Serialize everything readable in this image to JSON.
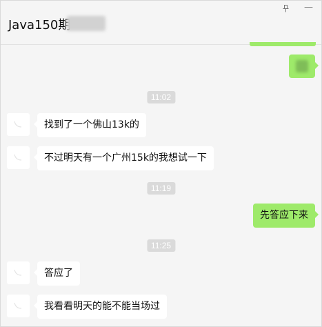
{
  "header": {
    "title": "Java150期"
  },
  "window_controls": {
    "pin_icon": "pin-icon",
    "minimize_icon": "minimize-icon"
  },
  "messages": [
    {
      "type": "time",
      "text": "11:02"
    },
    {
      "type": "incoming",
      "text": "找到了一个佛山13k的"
    },
    {
      "type": "incoming",
      "text": "不过明天有一个广州15k的我想试一下"
    },
    {
      "type": "time",
      "text": "11:19"
    },
    {
      "type": "outgoing",
      "text": "先答应下来"
    },
    {
      "type": "time",
      "text": "11:25"
    },
    {
      "type": "incoming",
      "text": "答应了"
    },
    {
      "type": "incoming",
      "text": "我看看明天的能不能当场过"
    }
  ],
  "colors": {
    "outgoing_bubble": "#9eea6a",
    "incoming_bubble": "#ffffff",
    "time_badge": "#dadada",
    "background": "#f5f5f5"
  }
}
